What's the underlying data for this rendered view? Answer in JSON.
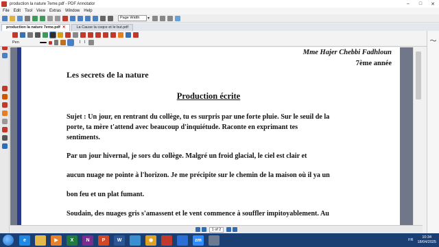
{
  "window": {
    "title": "production la nature 7eme.pdf - PDF Annotator",
    "min": "–",
    "max": "□",
    "close": "✕"
  },
  "menu": [
    "File",
    "Edit",
    "Tool",
    "View",
    "Extras",
    "Window",
    "Help"
  ],
  "toolbar": {
    "zoom_value": "Page Width"
  },
  "tabs": [
    {
      "label": "production la nature 7eme.pdf",
      "active": true
    },
    {
      "label": "La Cause la csqce et le but.pdf",
      "active": false
    }
  ],
  "tools": {
    "pen_label": "Pen"
  },
  "document": {
    "author": "Mme Hajer Chebbi Fadhloun",
    "grade": "7ème année",
    "heading": "Les secrets de la nature",
    "title": "Production écrite",
    "lines": [
      "Sujet : Un jour, en rentrant du collège, tu es surpris par une forte pluie. Sur le seuil de la",
      "porte, ta mère t'attend avec beaucoup d'inquiétude. Raconte en exprimant tes",
      "sentiments.",
      "        Par un jour hivernal, je sors du collège. Malgré un froid glacial, le ciel est clair et",
      "aucun nuage ne pointe à l'horizon. Je me précipite sur le chemin de la maison où il ya un",
      "bon feu et un plat fumant.",
      "Soudain, des nuages gris s'amassent et le vent commence à souffler impitoyablement. Au"
    ]
  },
  "status": {
    "page_indicator": "1 of 2"
  },
  "taskbar": {
    "apps": [
      {
        "name": "ie-icon",
        "color": "#1e88e5",
        "glyph": "e"
      },
      {
        "name": "folder-icon",
        "color": "#e6b84a",
        "glyph": ""
      },
      {
        "name": "media-icon",
        "color": "#e8802a",
        "glyph": "▶"
      },
      {
        "name": "excel-icon",
        "color": "#1f7a3e",
        "glyph": "X"
      },
      {
        "name": "onenote-icon",
        "color": "#7a2d8f",
        "glyph": "N"
      },
      {
        "name": "powerpoint-icon",
        "color": "#d24726",
        "glyph": "P"
      },
      {
        "name": "word-icon",
        "color": "#2b5797",
        "glyph": "W"
      },
      {
        "name": "pictures-icon",
        "color": "#3a8fd1",
        "glyph": ""
      },
      {
        "name": "chrome-icon",
        "color": "#e0a020",
        "glyph": "◉"
      },
      {
        "name": "pdf-annotator-icon",
        "color": "#c0392b",
        "glyph": ""
      },
      {
        "name": "app-icon",
        "color": "#2a6fd6",
        "glyph": ""
      },
      {
        "name": "zoom-icon",
        "color": "#2d8cff",
        "glyph": "zm"
      },
      {
        "name": "settings-icon",
        "color": "#6b7a8f",
        "glyph": ""
      }
    ],
    "lang": "FR",
    "time": "10:34",
    "date": "18/04/2025"
  }
}
